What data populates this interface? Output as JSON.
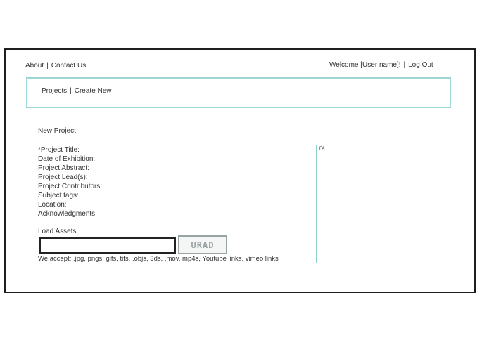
{
  "header": {
    "nav": [
      {
        "label": "About"
      },
      {
        "label": "Contact Us"
      }
    ],
    "separator": "|",
    "welcome": "Welcome [User name]!",
    "logout": "Log Out"
  },
  "subnav": {
    "links": [
      {
        "label": "Projects"
      },
      {
        "label": "Create New"
      }
    ]
  },
  "form": {
    "section_title": "New Project",
    "fields": [
      {
        "label": "*Project Title:"
      },
      {
        "label": "Date of Exhibition:"
      },
      {
        "label": "Project Abstract:"
      },
      {
        "label": "Project Lead(s):"
      },
      {
        "label": "Project Contributors:"
      },
      {
        "label": "Subject tags:"
      },
      {
        "label": "Location:"
      },
      {
        "label": "Acknowledgments:"
      }
    ],
    "load_assets_label": "Load Assets",
    "file_value": "",
    "upload_label": "URAD",
    "accept_text": "We accept: .jpg, pngs, gifs, tifs, .objs, 3ds, .mov, mp4s, Youtube links, vimeo links"
  },
  "side_panel": {
    "label": "FA"
  },
  "colors": {
    "accent": "#9ed8d6",
    "frame_border": "#1e1e1e",
    "text": "#333333"
  }
}
